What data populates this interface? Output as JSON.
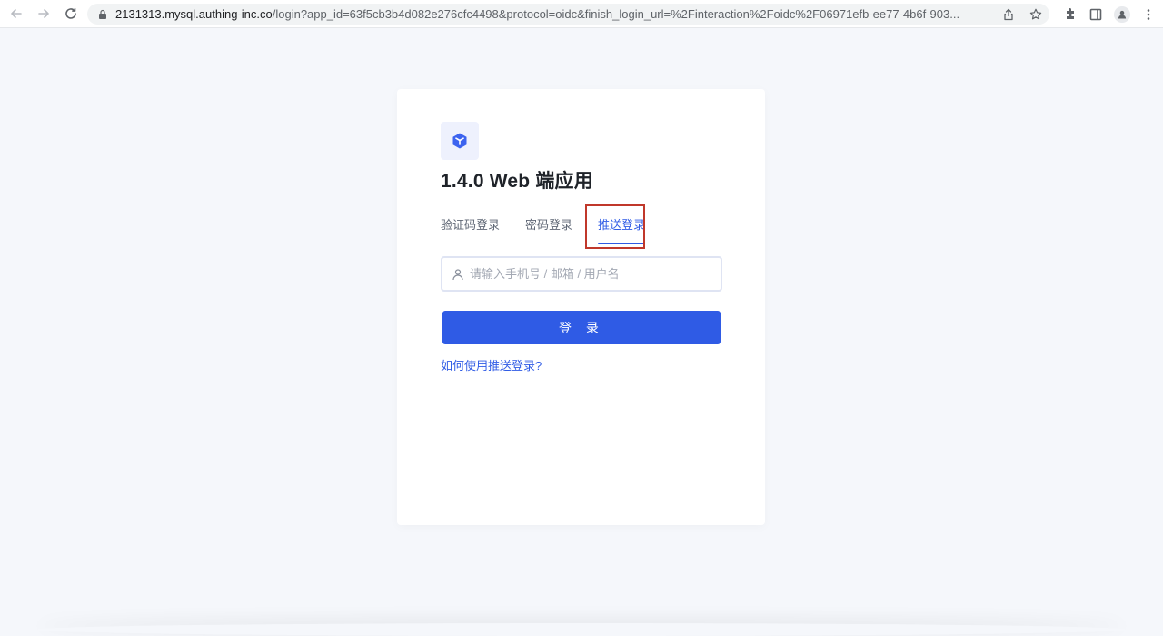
{
  "browser": {
    "url_host": "2131313.mysql.authing-inc.co",
    "url_path": "/login?app_id=63f5cb3b4d082e276cfc4498&protocol=oidc&finish_login_url=%2Finteraction%2Foidc%2F06971efb-ee77-4b6f-903..."
  },
  "app": {
    "title": "1.4.0 Web 端应用"
  },
  "tabs": [
    {
      "label": "验证码登录",
      "active": false
    },
    {
      "label": "密码登录",
      "active": false
    },
    {
      "label": "推送登录",
      "active": true
    }
  ],
  "form": {
    "account_placeholder": "请输入手机号 / 邮箱 / 用户名",
    "account_value": "",
    "submit_label": "登 录",
    "help_link": "如何使用推送登录?"
  },
  "colors": {
    "accent": "#2f5be5",
    "highlight": "#c0382b"
  },
  "icons": {
    "back": "arrow-left-icon",
    "forward": "arrow-right-icon",
    "reload": "reload-icon",
    "lock": "lock-icon",
    "share": "share-icon",
    "bookmark": "star-icon",
    "extensions": "puzzle-icon",
    "side_panel": "side-panel-icon",
    "profile": "profile-icon",
    "menu": "more-vert-icon",
    "app_logo": "cube-icon",
    "user": "user-icon"
  }
}
